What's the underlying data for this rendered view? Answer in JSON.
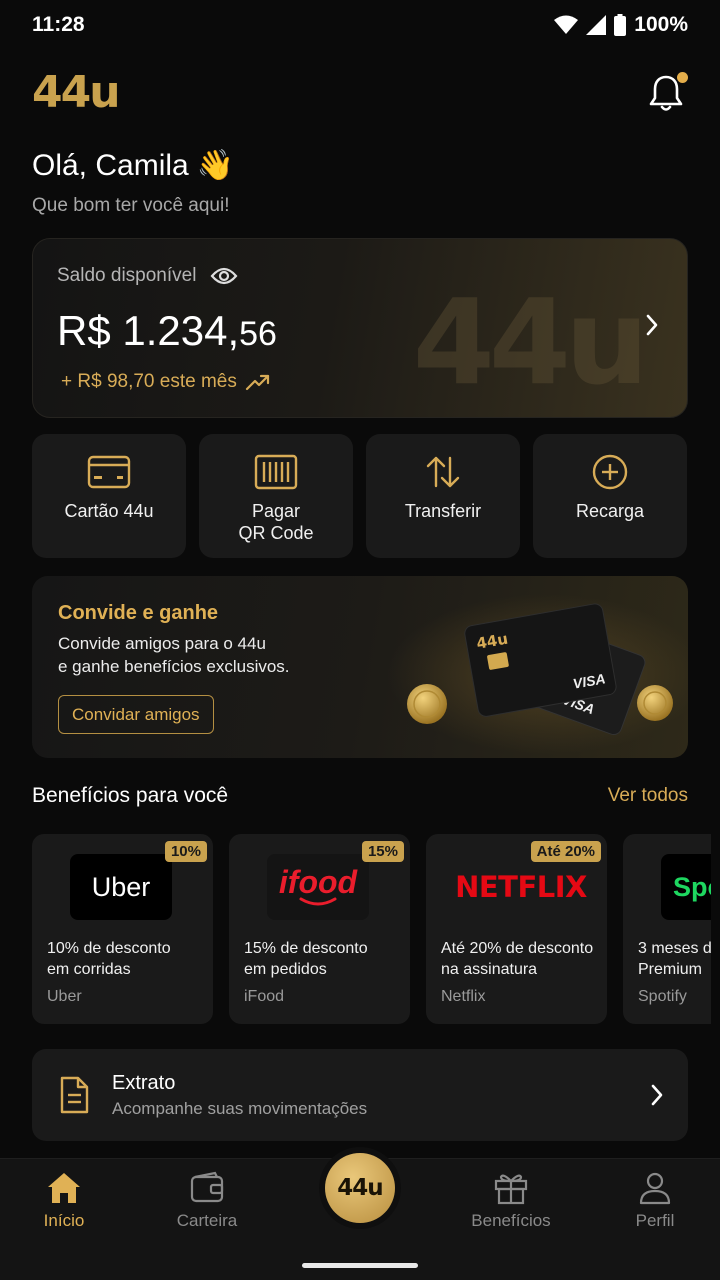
{
  "status_bar": {
    "time": "11:28",
    "battery": "100%"
  },
  "header": {
    "logo_text": "44u"
  },
  "greeting": {
    "title": "Olá, Camila",
    "emoji": "👋",
    "subtitle": "Que bom ter você aqui!"
  },
  "balance": {
    "label": "Saldo disponível",
    "amount_main": "R$ 1.234,",
    "amount_cents": "56",
    "gain": "+ R$ 98,70 este mês",
    "watermark": "44u"
  },
  "actions": [
    {
      "label": "Cartão 44u",
      "icon": "card-icon"
    },
    {
      "label": "Pagar\nQR Code",
      "line1": "Pagar",
      "line2": "QR Code",
      "icon": "barcode-icon"
    },
    {
      "label": "Transferir",
      "icon": "transfer-arrows-icon"
    },
    {
      "label": "Recarga",
      "icon": "plus-circle-icon"
    }
  ],
  "promo": {
    "title": "Convide e ganhe",
    "desc_line1": "Convide amigos para o 44u",
    "desc_line2": "e ganhe benefícios exclusivos.",
    "button": "Convidar amigos",
    "card_brand": "VISA",
    "card_logo": "44u"
  },
  "benefits_section": {
    "title": "Benefícios para você",
    "link": "Ver todos"
  },
  "benefits": [
    {
      "badge": "10%",
      "logo": "Uber",
      "line1": "10% de desconto",
      "line2": "em corridas",
      "brand": "Uber"
    },
    {
      "badge": "15%",
      "logo": "ifood",
      "line1": "15% de desconto",
      "line2": "em pedidos",
      "brand": "iFood"
    },
    {
      "badge": "Até 20%",
      "logo": "NETFLIX",
      "line1": "Até 20% de desconto",
      "line2": "na assinatura",
      "brand": "Netflix"
    },
    {
      "badge": "",
      "logo": "Spo",
      "line1": "3 meses d",
      "line2": "Premium",
      "brand": "Spotify"
    }
  ],
  "extrato": {
    "title": "Extrato",
    "subtitle": "Acompanhe suas movimentações"
  },
  "tabbar": {
    "tabs": [
      {
        "label": "Início",
        "icon": "home-icon",
        "active": true
      },
      {
        "label": "Carteira",
        "icon": "wallet-icon",
        "active": false
      },
      {
        "label": "Benefícios",
        "icon": "gift-icon",
        "active": false
      },
      {
        "label": "Perfil",
        "icon": "user-icon",
        "active": false
      }
    ],
    "center_logo": "44u"
  },
  "colors": {
    "accent": "#d8ac57",
    "background": "#0a0a0a",
    "card": "#1a1a1a"
  }
}
